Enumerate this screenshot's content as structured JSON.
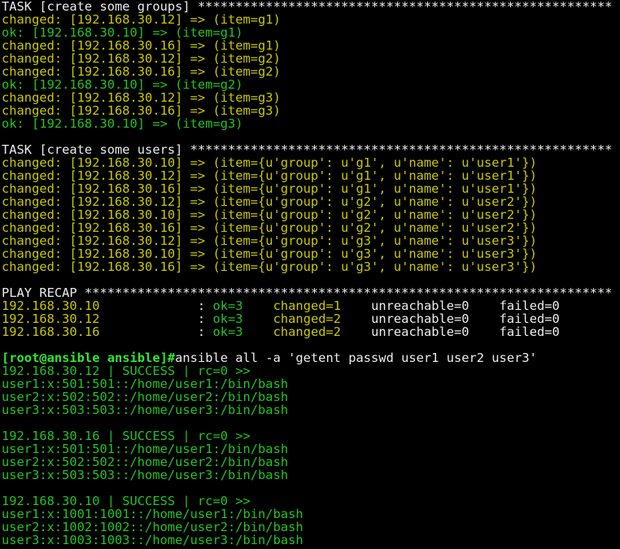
{
  "colors": {
    "background": "#000000",
    "default_text": "#ececec",
    "changed": "#c8c800",
    "ok": "#22c322",
    "prompt": "#2ee82e"
  },
  "terminal": {
    "task_groups_header": "TASK [create some groups] *******************************************************",
    "task_groups_lines": [
      {
        "status": "changed",
        "text": "changed: [192.168.30.12] => (item=g1)"
      },
      {
        "status": "ok",
        "text": "ok: [192.168.30.10] => (item=g1)"
      },
      {
        "status": "changed",
        "text": "changed: [192.168.30.16] => (item=g1)"
      },
      {
        "status": "changed",
        "text": "changed: [192.168.30.12] => (item=g2)"
      },
      {
        "status": "changed",
        "text": "changed: [192.168.30.16] => (item=g2)"
      },
      {
        "status": "ok",
        "text": "ok: [192.168.30.10] => (item=g2)"
      },
      {
        "status": "changed",
        "text": "changed: [192.168.30.12] => (item=g3)"
      },
      {
        "status": "changed",
        "text": "changed: [192.168.30.16] => (item=g3)"
      },
      {
        "status": "ok",
        "text": "ok: [192.168.30.10] => (item=g3)"
      }
    ],
    "task_users_header": "TASK [create some users] ********************************************************",
    "task_users_lines": [
      "changed: [192.168.30.10] => (item={u'group': u'g1', u'name': u'user1'})",
      "changed: [192.168.30.12] => (item={u'group': u'g1', u'name': u'user1'})",
      "changed: [192.168.30.16] => (item={u'group': u'g1', u'name': u'user1'})",
      "changed: [192.168.30.12] => (item={u'group': u'g2', u'name': u'user2'})",
      "changed: [192.168.30.10] => (item={u'group': u'g2', u'name': u'user2'})",
      "changed: [192.168.30.16] => (item={u'group': u'g2', u'name': u'user2'})",
      "changed: [192.168.30.12] => (item={u'group': u'g3', u'name': u'user3'})",
      "changed: [192.168.30.10] => (item={u'group': u'g3', u'name': u'user3'})",
      "changed: [192.168.30.16] => (item={u'group': u'g3', u'name': u'user3'})"
    ],
    "play_recap_header": "PLAY RECAP **********************************************************************",
    "recap_rows": [
      {
        "host": "192.168.30.10",
        "ok": "ok=3",
        "changed": "changed=1",
        "unreachable": "unreachable=0",
        "failed": "failed=0"
      },
      {
        "host": "192.168.30.12",
        "ok": "ok=3",
        "changed": "changed=2",
        "unreachable": "unreachable=0",
        "failed": "failed=0"
      },
      {
        "host": "192.168.30.16",
        "ok": "ok=3",
        "changed": "changed=2",
        "unreachable": "unreachable=0",
        "failed": "failed=0"
      }
    ],
    "prompt": "[root@ansible ansible]#",
    "command": "ansible all -a 'getent passwd user1 user2 user3'",
    "results": [
      {
        "header": "192.168.30.12 | SUCCESS | rc=0 >>",
        "lines": [
          "user1:x:501:501::/home/user1:/bin/bash",
          "user2:x:502:502::/home/user2:/bin/bash",
          "user3:x:503:503::/home/user3:/bin/bash"
        ]
      },
      {
        "header": "192.168.30.16 | SUCCESS | rc=0 >>",
        "lines": [
          "user1:x:501:501::/home/user1:/bin/bash",
          "user2:x:502:502::/home/user2:/bin/bash",
          "user3:x:503:503::/home/user3:/bin/bash"
        ]
      },
      {
        "header": "192.168.30.10 | SUCCESS | rc=0 >>",
        "lines": [
          "user1:x:1001:1001::/home/user1:/bin/bash",
          "user2:x:1002:1002::/home/user2:/bin/bash",
          "user3:x:1003:1003::/home/user3:/bin/bash"
        ]
      }
    ]
  }
}
